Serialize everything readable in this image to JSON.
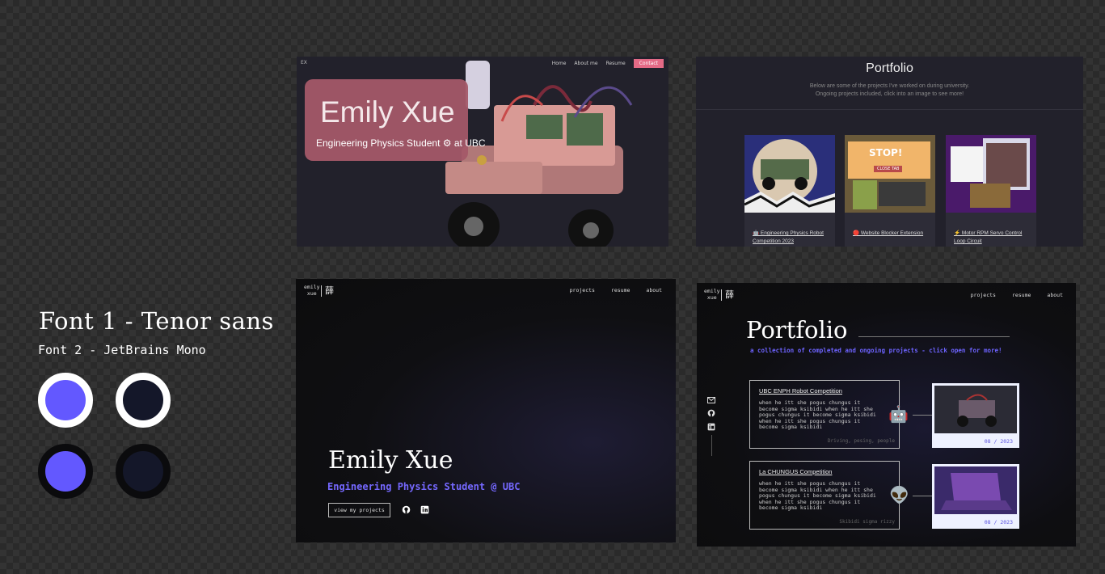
{
  "style_guide": {
    "font1": "Font 1 - Tenor sans",
    "font2": "Font 2 - JetBrains Mono",
    "colors": {
      "accent": "#6358ff",
      "navy": "#141729",
      "white": "#ffffff",
      "black": "#0b0b0d"
    }
  },
  "frame1": {
    "logo": "EX",
    "nav": [
      "Home",
      "About me",
      "Resume"
    ],
    "cta": "Contact",
    "name": "Emily Xue",
    "subtitle": "Engineering Physics Student ⚙ at UBC"
  },
  "frame2": {
    "title": "Portfolio",
    "desc_line1": "Below are some of the projects I've worked on during university.",
    "desc_line2": "Ongoing projects included, click into an image to see more!",
    "cards": [
      {
        "title": "🤖 Engineering Physics Robot Competition 2023"
      },
      {
        "title": "🔴 Website Blocker Extension"
      },
      {
        "title": "⚡ Motor RPM Servo Control Loop Circuit"
      }
    ],
    "card2_label": "STOP!",
    "card2_button": "CLOSE TAB"
  },
  "frame3": {
    "brand_line1": "emily",
    "brand_line2": "xue",
    "cjk": "薛",
    "nav": [
      "projects",
      "resume",
      "about"
    ],
    "name": "Emily Xue",
    "subtitle": "Engineering Physics Student @ UBC",
    "button": "view my projects"
  },
  "frame4": {
    "brand_line1": "emily",
    "brand_line2": "xue",
    "cjk": "薛",
    "nav": [
      "projects",
      "resume",
      "about"
    ],
    "title": "Portfolio",
    "tagline": "a collection of completed and ongoing projects - click open for more!",
    "projects": [
      {
        "title": "UBC ENPH Robot Competition",
        "desc": "when he itt she pogus chungus it become sigma ksibidi when he itt she pogus chungus it become sigma ksibidi when he itt she pogus chungus it become sigma ksibidi",
        "tags": "Driving, pesing, people",
        "emoji": "🤖",
        "date": "08 / 2023"
      },
      {
        "title": "La CHUNGUS Competition",
        "desc": "when he itt she pogus chungus it become sigma ksibidi when he itt she pogus chungus it become sigma ksibidi when he itt she pogus chungus it become sigma ksibidi",
        "tags": "Skibidi sigma rizzy",
        "emoji": "👽",
        "date": "08 / 2023"
      }
    ]
  }
}
